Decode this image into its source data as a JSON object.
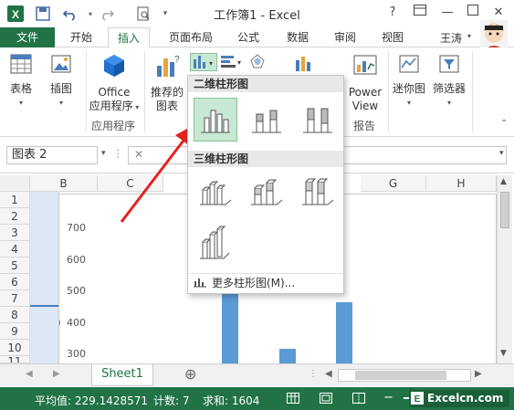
{
  "window": {
    "title": "工作簿1 - Excel",
    "help": "?",
    "min": "—",
    "close": "✕"
  },
  "tabs": [
    "文件",
    "开始",
    "插入",
    "页面布局",
    "公式",
    "数据",
    "审阅",
    "视图"
  ],
  "user": "王涛",
  "ribbon": {
    "table_label": "表格",
    "illustrations_label": "插图",
    "office_apps_line1": "Office",
    "office_apps_line2": "应用程序",
    "apps_group_label": "应用程序",
    "recommended_line1": "推荐的",
    "recommended_line2": "图表",
    "power_view_line1": "Power",
    "power_view_line2": "View",
    "reports_group_label": "报告",
    "sparkline_label": "迷你图",
    "filter_label": "筛选器"
  },
  "formula_bar": {
    "name_box": "图表 2"
  },
  "columns": [
    "B",
    "C",
    "G",
    "H"
  ],
  "rows": [
    "1",
    "2",
    "3",
    "4",
    "5",
    "6",
    "7",
    "8",
    "9",
    "10",
    "11"
  ],
  "dropdown": {
    "section_2d": "二维柱形图",
    "section_3d": "三维柱形图",
    "more_link": "更多柱形图(M)..."
  },
  "chart_data": {
    "type": "bar",
    "yticks": [
      700,
      600,
      500,
      400,
      300
    ],
    "ylim": [
      200,
      750
    ],
    "bars": [
      {
        "x_center": 0.39,
        "value": 530
      },
      {
        "x_center": 0.52,
        "value": 320
      },
      {
        "x_center": 0.65,
        "value": 465
      }
    ]
  },
  "sheet": {
    "tab": "Sheet1",
    "add": "⊕"
  },
  "status": {
    "average": "平均值: 229.1428571",
    "count": "计数: 7",
    "sum": "求和: 1604",
    "brand": "Excelcn.com"
  }
}
